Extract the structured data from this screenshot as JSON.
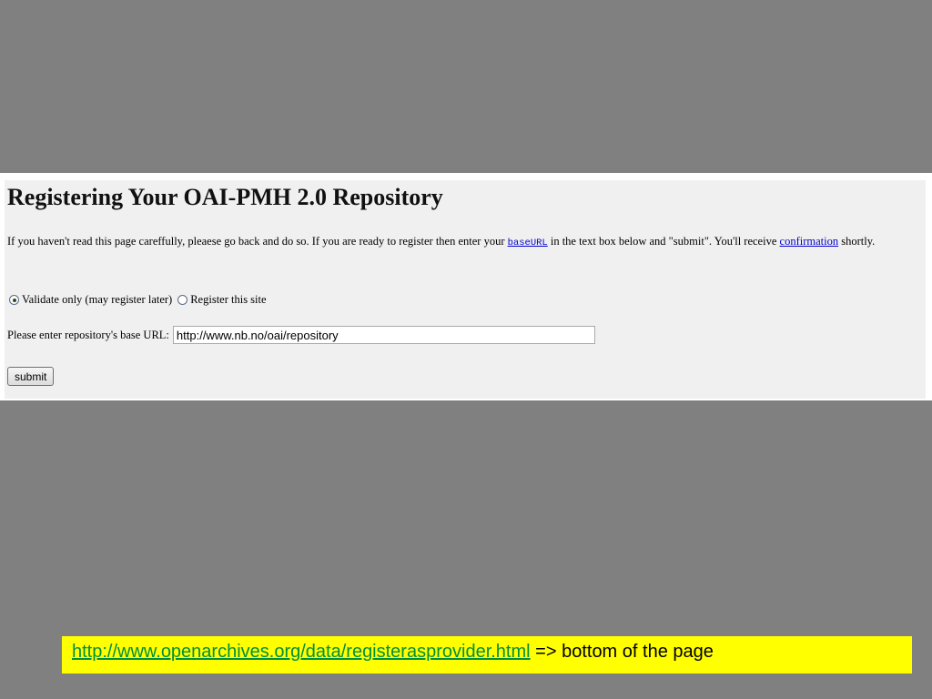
{
  "page": {
    "title": "Registering Your OAI-PMH 2.0 Repository",
    "intro": {
      "text_before": "If you haven't read this page careffully, pleaese go back and do so. If you are ready to register then enter your ",
      "baseurl_link": "baseURL",
      "text_middle": " in the text box below and \"submit\".  You'll receive ",
      "confirmation_link": "confirmation",
      "text_after": " shortly."
    },
    "options": {
      "validate_label": "Validate only (may register later)",
      "register_label": "Register this site",
      "selected": "validate"
    },
    "url_field": {
      "label": "Please enter repository's base URL:",
      "value": "http://www.nb.no/oai/repository"
    },
    "submit_label": "submit"
  },
  "caption": {
    "link_text": "http://www.openarchives.org/data/registerasprovider.html",
    "arrow": "=>",
    "suffix": "bottom of the page",
    "background_color": "#ffff00",
    "link_color": "#008f3c"
  },
  "colors": {
    "slide_background": "#808080",
    "page_background": "#f0f0f0",
    "link": "#0000cc"
  }
}
